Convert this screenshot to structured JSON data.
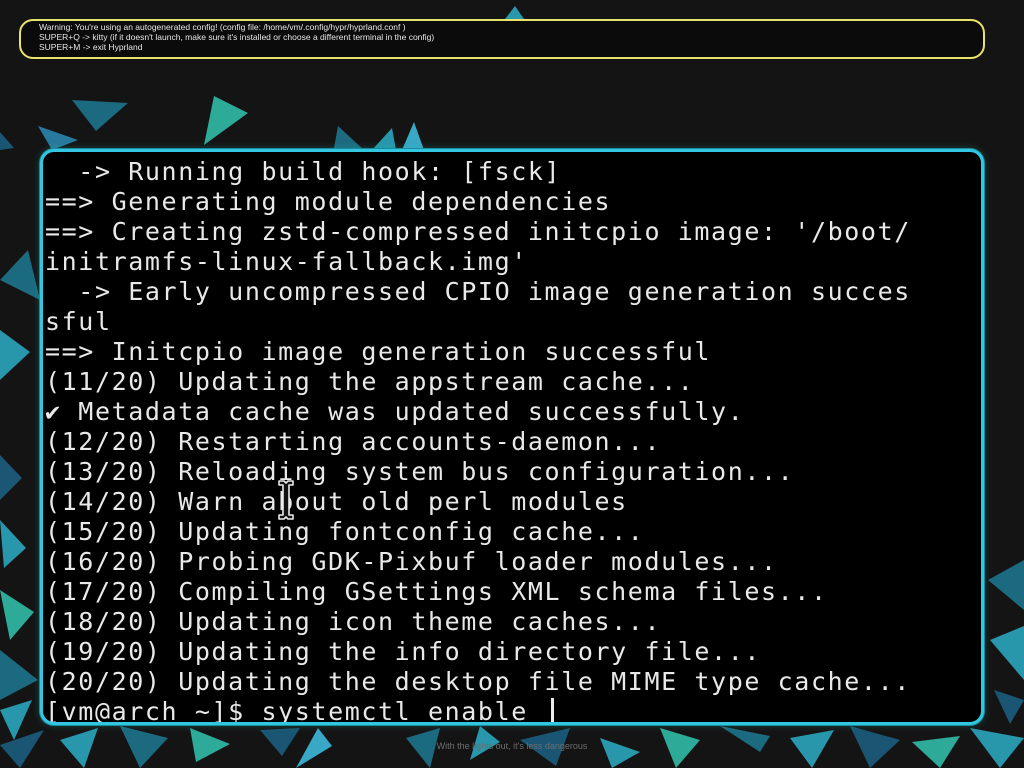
{
  "notification": {
    "lines": [
      "Warning: You're using an autogenerated config! (config file: /home/vm/.config/hypr/hyprland.conf )",
      "SUPER+Q -> kitty (if it doesn't launch, make sure it's installed or choose a different terminal in the config)",
      "SUPER+M -> exit Hyprland"
    ],
    "border_color": "#e8e36a"
  },
  "terminal": {
    "border_color": "#33c6e0",
    "lines": [
      "  -> Running build hook: [fsck]",
      "==> Generating module dependencies",
      "==> Creating zstd-compressed initcpio image: '/boot/",
      "initramfs-linux-fallback.img'",
      "  -> Early uncompressed CPIO image generation succes",
      "sful",
      "==> Initcpio image generation successful",
      "(11/20) Updating the appstream cache...",
      "✔ Metadata cache was updated successfully.",
      "(12/20) Restarting accounts-daemon...",
      "(13/20) Reloading system bus configuration...",
      "(14/20) Warn about old perl modules",
      "(15/20) Updating fontconfig cache...",
      "(16/20) Probing GDK-Pixbuf loader modules...",
      "(17/20) Compiling GSettings XML schema files...",
      "(18/20) Updating icon theme caches...",
      "(19/20) Updating the info directory file...",
      "(20/20) Updating the desktop file MIME type cache..."
    ],
    "prompt": "[vm@arch ~]$ ",
    "command": "systemctl enable "
  },
  "wallpaper": {
    "caption": "With the lights out, it's less dangerous",
    "colors": [
      "#2a9fb5",
      "#1d6f86",
      "#2fb3a0",
      "#1b5a7a",
      "#3ab0d0"
    ]
  }
}
